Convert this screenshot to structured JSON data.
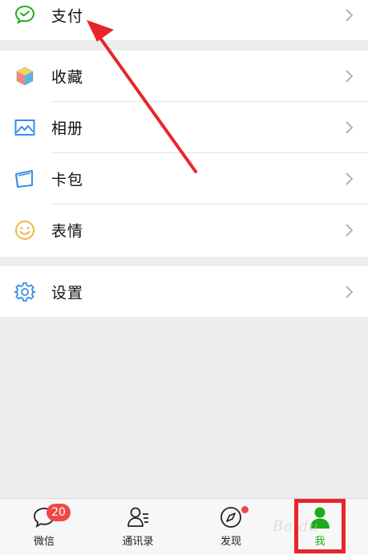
{
  "menu": {
    "payment": {
      "label": "支付",
      "icon": "wechat-pay-icon"
    },
    "collections": {
      "label": "收藏",
      "icon": "cube-icon"
    },
    "album": {
      "label": "相册",
      "icon": "picture-icon"
    },
    "cards": {
      "label": "卡包",
      "icon": "card-wallet-icon"
    },
    "stickers": {
      "label": "表情",
      "icon": "smiley-icon"
    },
    "settings": {
      "label": "设置",
      "icon": "gear-icon"
    }
  },
  "tabbar": {
    "chats": {
      "label": "微信",
      "badge": "20",
      "icon": "chat-bubble-icon"
    },
    "contacts": {
      "label": "通讯录",
      "icon": "contacts-icon"
    },
    "discover": {
      "label": "发现",
      "icon": "compass-icon"
    },
    "me": {
      "label": "我",
      "icon": "person-icon",
      "active": true
    }
  },
  "colors": {
    "accent_green": "#1aad19",
    "annotation_red": "#e8252b",
    "badge_red": "#f04848",
    "background": "#ededed"
  },
  "annotations": {
    "arrow": "red-pointer-arrow",
    "highlight_box": "red-rectangle"
  }
}
